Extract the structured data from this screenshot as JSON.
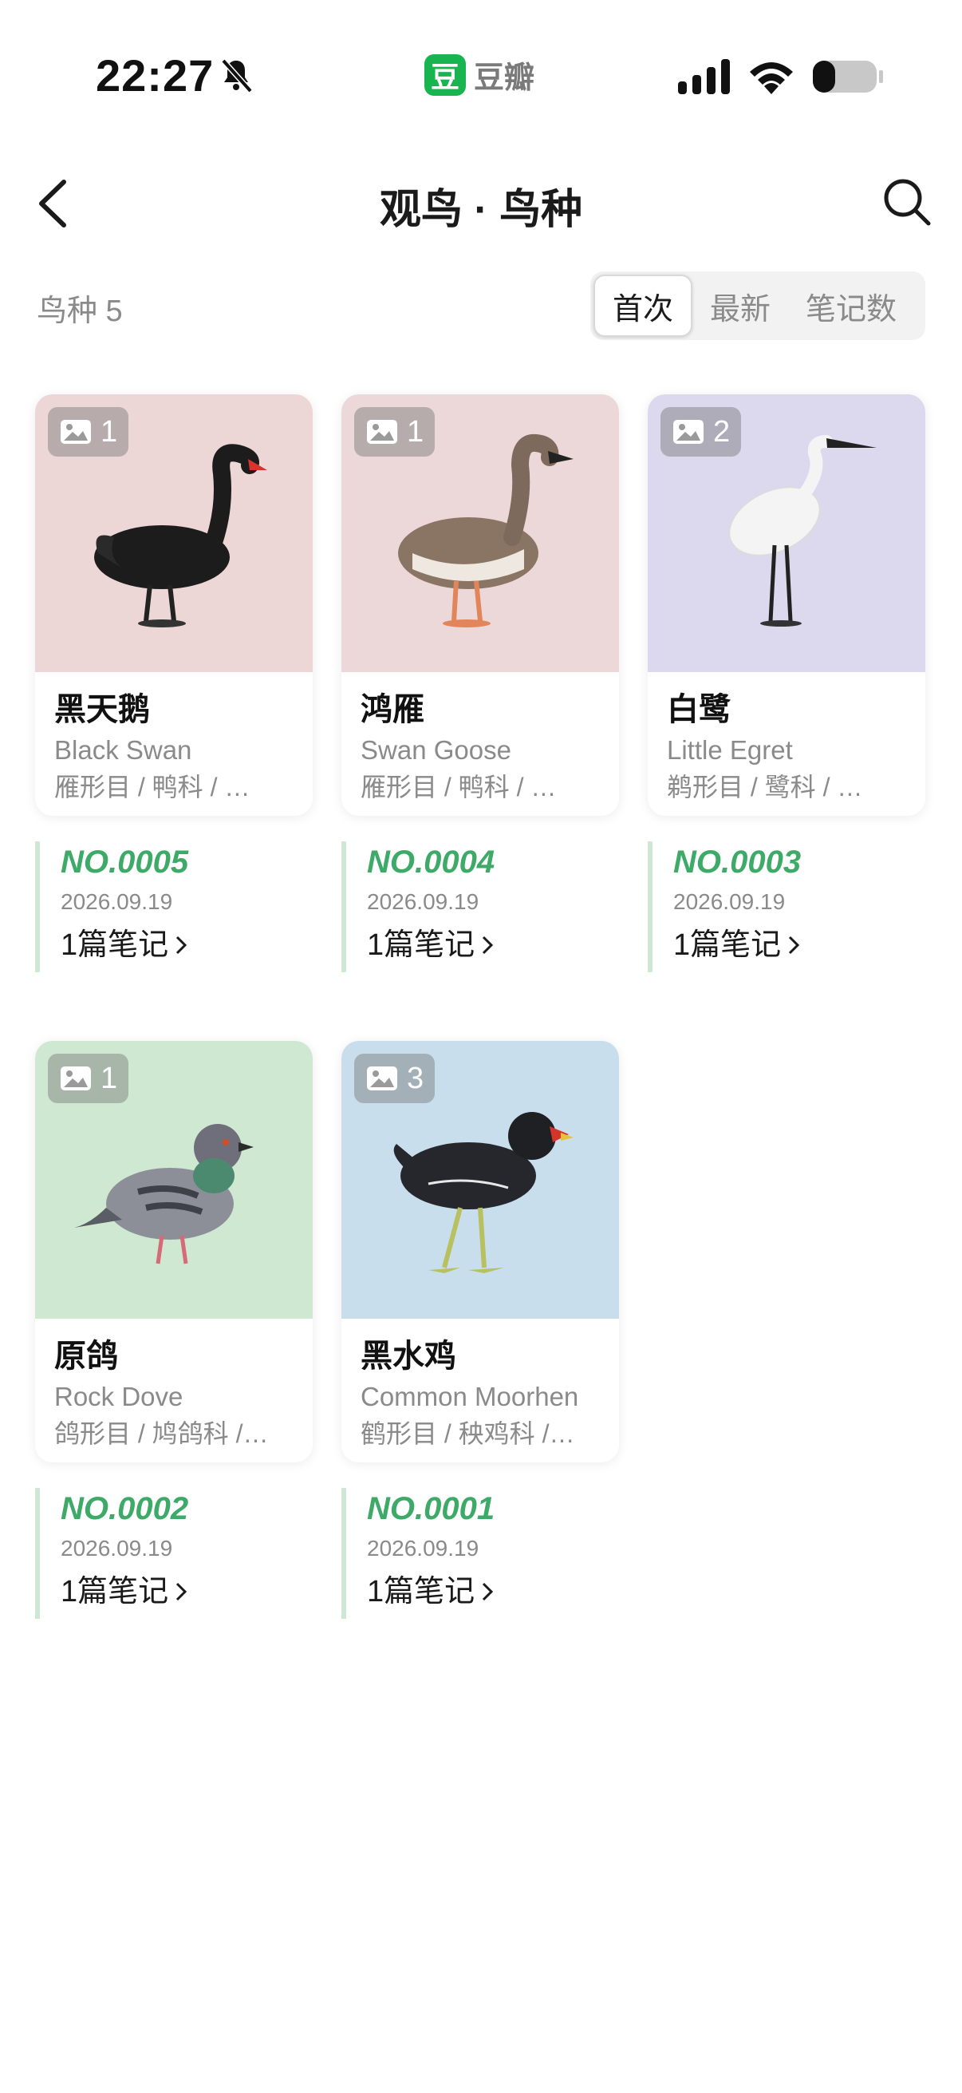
{
  "status_bar": {
    "time": "22:27",
    "app_logo_char": "豆",
    "app_name": "豆瓣",
    "accent": "#18b450"
  },
  "header": {
    "title": "观鸟 · 鸟种"
  },
  "filter": {
    "count_label": "鸟种 5",
    "sort_tabs": [
      {
        "label": "首次",
        "active": true
      },
      {
        "label": "最新",
        "active": false
      },
      {
        "label": "笔记数",
        "active": false
      }
    ]
  },
  "colors": {
    "record_number": "#3daa67",
    "record_border": "#cde8d3"
  },
  "species": [
    {
      "cn_name": "黑天鹅",
      "en_name": "Black Swan",
      "taxon": "雁形目 / 鸭科 / …",
      "photo_count": "1",
      "photo_bg": "#ecd6d6",
      "bird_icon": "black-swan",
      "record_no": "NO.0005",
      "date": "2026.09.19",
      "notes_link": "1篇笔记"
    },
    {
      "cn_name": "鸿雁",
      "en_name": "Swan Goose",
      "taxon": "雁形目 / 鸭科 / …",
      "photo_count": "1",
      "photo_bg": "#ecd8d8",
      "bird_icon": "swan-goose",
      "record_no": "NO.0004",
      "date": "2026.09.19",
      "notes_link": "1篇笔记"
    },
    {
      "cn_name": "白鹭",
      "en_name": "Little Egret",
      "taxon": "鹈形目 / 鹭科 / …",
      "photo_count": "2",
      "photo_bg": "#dcd8ee",
      "bird_icon": "little-egret",
      "record_no": "NO.0003",
      "date": "2026.09.19",
      "notes_link": "1篇笔记"
    },
    {
      "cn_name": "原鸽",
      "en_name": "Rock Dove",
      "taxon": "鸽形目 / 鸠鸽科 /…",
      "photo_count": "1",
      "photo_bg": "#cfe8d2",
      "bird_icon": "rock-dove",
      "record_no": "NO.0002",
      "date": "2026.09.19",
      "notes_link": "1篇笔记"
    },
    {
      "cn_name": "黑水鸡",
      "en_name": "Common Moorhen",
      "taxon": "鹤形目 / 秧鸡科 /…",
      "photo_count": "3",
      "photo_bg": "#c9deec",
      "bird_icon": "common-moorhen",
      "record_no": "NO.0001",
      "date": "2026.09.19",
      "notes_link": "1篇笔记"
    }
  ]
}
